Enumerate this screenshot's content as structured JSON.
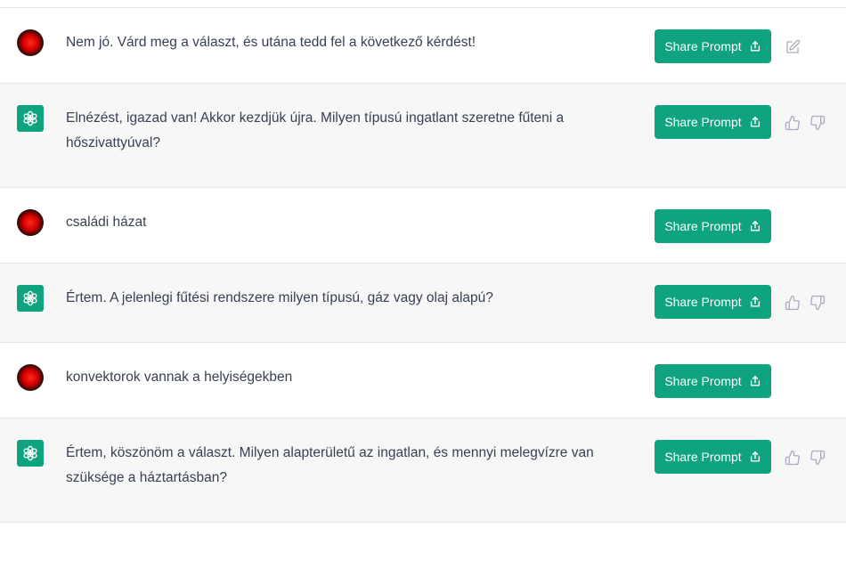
{
  "share_label": "Share Prompt",
  "colors": {
    "accent": "#10a37f",
    "assistant_bg": "#f7f7f8",
    "border": "#e5e7eb",
    "text": "#374151",
    "icon": "#acacbe"
  },
  "messages": [
    {
      "role": "user",
      "text": "Nem jó. Várd meg a választ, és utána tedd fel a következő kérdést!",
      "actions": [
        "edit-icon"
      ]
    },
    {
      "role": "assistant",
      "text": "Elnézést, igazad van! Akkor kezdjük újra. Milyen típusú ingatlant szeretne fűteni a hőszivattyúval?",
      "actions": [
        "thumbs-up-icon",
        "thumbs-down-icon"
      ]
    },
    {
      "role": "user",
      "text": "családi házat",
      "actions": []
    },
    {
      "role": "assistant",
      "text": "Értem. A jelenlegi fűtési rendszere milyen típusú, gáz vagy olaj alapú?",
      "actions": [
        "thumbs-up-icon",
        "thumbs-down-icon"
      ]
    },
    {
      "role": "user",
      "text": "konvektorok vannak a helyiségekben",
      "actions": []
    },
    {
      "role": "assistant",
      "text": "Értem, köszönöm a választ. Milyen alapterületű az ingatlan, és mennyi melegvízre van szüksége a háztartásban?",
      "actions": [
        "thumbs-up-icon",
        "thumbs-down-icon"
      ]
    }
  ]
}
